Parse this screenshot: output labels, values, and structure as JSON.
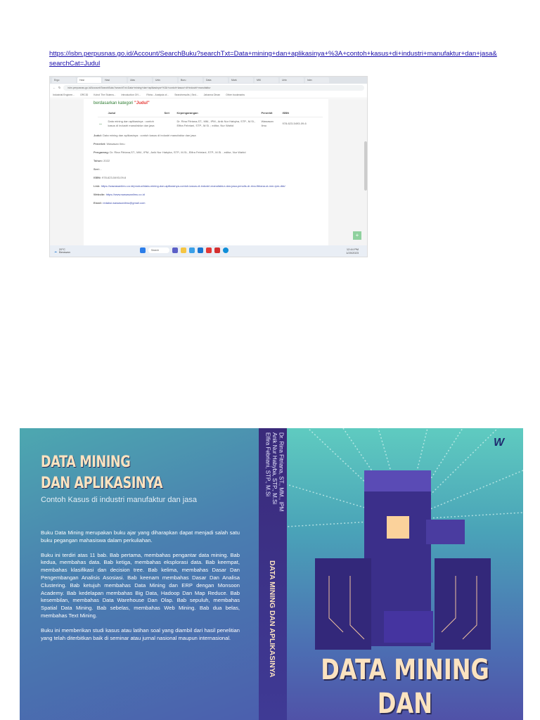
{
  "source_link": {
    "url": "https://isbn.perpusnas.go.id/Account/SearchBuku?searchTxt=Data+mining+dan+aplikasinya+%3A+contoh+kasus+di+industri+manufaktur+dan+jasa&searchCat=Judul"
  },
  "screenshot": {
    "tabs": [
      "Ergo",
      "Hasi",
      "Hasi",
      "Ulas",
      "Univ",
      "Buru",
      "Data",
      "Mark",
      "MKI",
      "Univ",
      "Isbn"
    ],
    "address": "isbn.perpusnas.go.id/Account/SearchBuku?searchTxt=Data+mining+dan+aplikasinya+%3A+contoh+kasus+di+industri+manufaktur",
    "bookmarks": [
      "Industrial Enginee...",
      "ORCID",
      "Kobo! The Stutera...",
      "Introduction Of I...",
      "Rhino - Analysis of...",
      "Searchresults | Sed...",
      "Jahanna Dinan",
      "Other bookmarks"
    ],
    "heading": "berdasarkan kategori",
    "heading_cat": "\"Judul\"",
    "table": {
      "headers": [
        "Judul",
        "Seri",
        "Kepengarangan",
        "Penerbit",
        "ISBN"
      ],
      "row": {
        "judul": "Data mining dan aplikasinya : contoh kasus di industri manufaktur dan jasa",
        "seri": "",
        "kepengarangan": "Dr. Rina Fitriana,ST., MM., IPM., Anik Nur Habyba, STP., M.Si., Elfira Febriani, STP., M.Si. ; editor, Nur Wahid",
        "penerbit": "Wawasan Ilmu",
        "isbn": "978-623-5493-09-6"
      }
    },
    "details": [
      {
        "label": "Judul:",
        "value": "Data mining dan aplikasinya : contoh kasus di industri manufaktur dan jasa"
      },
      {
        "label": "Penerbit:",
        "value": "Wawasan Ilmu"
      },
      {
        "label": "Pengarang:",
        "value": "Dr. Rina Fitriana,ST., MM., IPM., Anik Nur Habyba, STP., M.Si., Elfira Febriani, STP., M.Si. ; editor, Nur Wahid"
      },
      {
        "label": "Tahun:",
        "value": "2022"
      },
      {
        "label": "Seri:",
        "value": "-"
      },
      {
        "label": "ISBN:",
        "value": "978-623-5493-09-6"
      },
      {
        "label": "Link:",
        "value": "https://wawasanilmu.co.id/product/data-mining-dan-aplikasinya-contoh-kasus-di-industri-manufaktur-dan-jasa-penulis-dr-rina-fitriana-st-mm-ipm-dkk/"
      },
      {
        "label": "Website:",
        "value": "https://www.wawasanilmu.co.id"
      },
      {
        "label": "Email:",
        "value": "redaksi.wawasanilmu@gmail.com"
      }
    ],
    "weather": {
      "temp": "29°C",
      "desc": "Berawan"
    },
    "search": "Search",
    "clock": {
      "time": "12:44 PM",
      "date": "1/20/2023"
    }
  },
  "cover": {
    "back_title_line1": "DATA MINING",
    "back_title_line2": "DAN APLIKASINYA",
    "subtitle": "Contoh Kasus di industri manufaktur dan jasa",
    "paragraphs": [
      "Buku Data Mining merupakan buku ajar yang diharapkan dapat menjadi salah satu buku pegangan mahasiswa dalam perkuliahan.",
      "Buku ini terdiri atas 11 bab. Bab pertama, membahas pengantar data mining. Bab kedua, membahas data. Bab ketiga, membahas eksplorasi data. Bab keempat, membahas klasifikasi dan decision tree. Bab kelima, membahas Dasar Dan Pengembangan Analisis Asosiasi. Bab keenam membahas Dasar Dan Analisa Clustering. Bab ketujuh membahas Data Mining dan ERP dengan Monsoon Academy. Bab kedelapan membahas Big Data, Hadoop Dan Map Reduce. Bab kesembilan, membahas Data Warehouse Dan Olap. Bab sepuluh, membahas Spatial Data Mining. Bab sebelas, membahas Web Mining. Bab dua belas, membahas Text Mining.",
      "Buku ini memberikan studi kasus atau latihan soal yang diambil dari hasil penelitian yang telah diterbitkan baik di seminar atau jurnal nasional maupun internasional."
    ],
    "spine_authors": [
      "Dr. Rina Fitriana, ST., MM., IPM",
      "Anik Nur Habyba, STP., M.Si",
      "Elfira Febriani, STP., M.Si"
    ],
    "spine_title": "DATA MINING DAN APLIKASINYA",
    "front_title_line1": "DATA MINING",
    "front_title_line2": "DAN APLIKASINYA",
    "publisher_logo": "WAWASAN ILMU"
  }
}
